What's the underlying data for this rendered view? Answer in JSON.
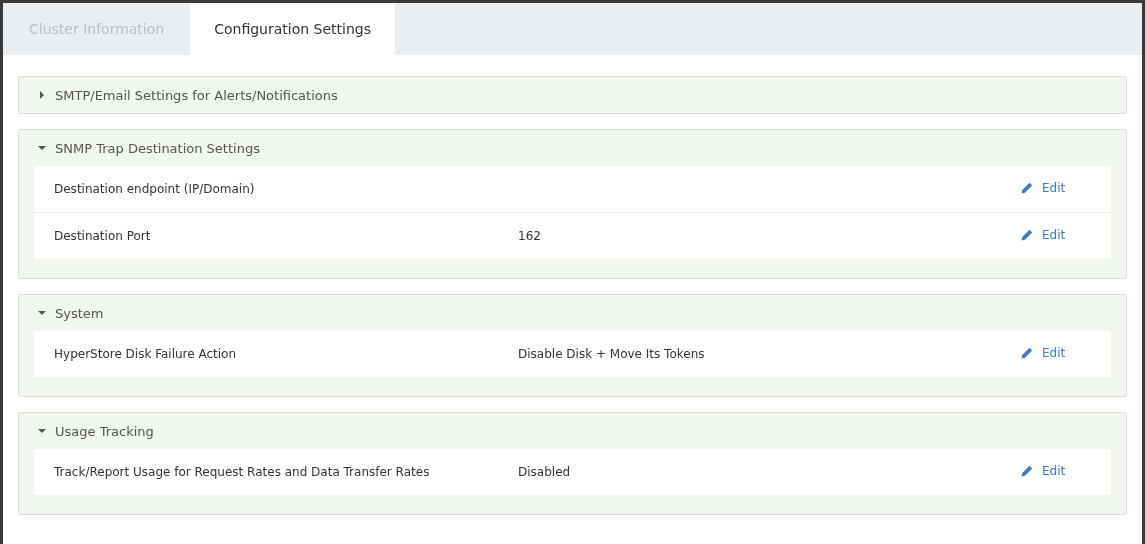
{
  "tabs": [
    {
      "label": "Cluster Information",
      "selected": false
    },
    {
      "label": "Configuration Settings",
      "selected": true
    }
  ],
  "sections": [
    {
      "title": "SMTP/Email Settings for Alerts/Notifications",
      "expanded": false
    },
    {
      "title": "SNMP Trap Destination Settings",
      "expanded": true,
      "rows": [
        {
          "label": "Destination endpoint (IP/Domain)",
          "action": "Edit"
        },
        {
          "label": "Destination Port",
          "value": "162",
          "action": "Edit"
        }
      ]
    },
    {
      "title": "System",
      "expanded": true,
      "rows": [
        {
          "label": "HyperStore Disk Failure Action",
          "value": "Disable Disk + Move Its Tokens",
          "action": "Edit"
        }
      ]
    },
    {
      "title": "Usage Tracking",
      "expanded": true,
      "rows": [
        {
          "label": "Track/Report Usage for Request Rates and Data Transfer Rates",
          "value": "Disabled",
          "action": "Edit"
        }
      ]
    }
  ]
}
